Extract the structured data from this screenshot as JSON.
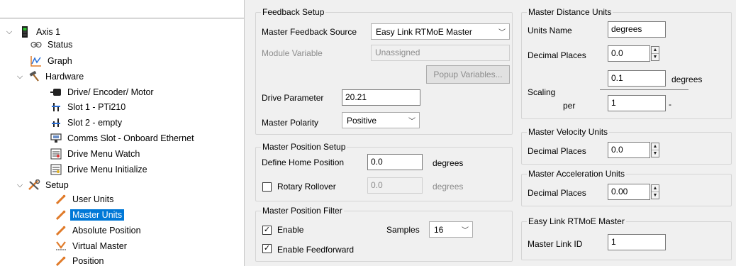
{
  "tree": {
    "axis": "Axis 1",
    "status": "Status",
    "graph": "Graph",
    "hardware": "Hardware",
    "drive_encoder_motor": "Drive/ Encoder/ Motor",
    "slot1": "Slot 1 - PTi210",
    "slot2": "Slot 2 - empty",
    "comms_slot": "Comms Slot - Onboard Ethernet",
    "drive_menu_watch": "Drive Menu Watch",
    "drive_menu_initialize": "Drive Menu Initialize",
    "setup": "Setup",
    "user_units": "User Units",
    "master_units": "Master Units",
    "absolute_position": "Absolute Position",
    "virtual_master": "Virtual Master",
    "position": "Position"
  },
  "feedback_setup": {
    "title": "Feedback Setup",
    "source_label": "Master Feedback Source",
    "source_value": "Easy Link RTMoE Master",
    "module_variable_label": "Module Variable",
    "module_variable_value": "Unassigned",
    "popup_button": "Popup Variables...",
    "drive_parameter_label": "Drive Parameter",
    "drive_parameter_value": "20.21",
    "polarity_label": "Master Polarity",
    "polarity_value": "Positive"
  },
  "position_setup": {
    "title": "Master Position Setup",
    "home_label": "Define Home Position",
    "home_value": "0.0",
    "home_unit": "degrees",
    "rollover_label": "Rotary Rollover",
    "rollover_value": "0.0",
    "rollover_unit": "degrees",
    "rollover_checked": false
  },
  "position_filter": {
    "title": "Master Position Filter",
    "enable_label": "Enable",
    "enable_checked": true,
    "samples_label": "Samples",
    "samples_value": "16",
    "feedforward_label": "Enable Feedforward",
    "feedforward_checked": true
  },
  "distance_units": {
    "title": "Master Distance Units",
    "units_name_label": "Units Name",
    "units_name_value": "degrees",
    "decimal_label": "Decimal Places",
    "decimal_value": "0.0",
    "scaling_label": "Scaling",
    "scaling_top_value": "0.1",
    "scaling_top_unit": "degrees",
    "per_label": "per",
    "scaling_bottom_value": "1",
    "scaling_bottom_unit": "-"
  },
  "velocity_units": {
    "title": "Master Velocity Units",
    "decimal_label": "Decimal Places",
    "decimal_value": "0.0"
  },
  "acceleration_units": {
    "title": "Master Acceleration Units",
    "decimal_label": "Decimal Places",
    "decimal_value": "0.00"
  },
  "easy_link": {
    "title": "Easy Link RTMoE Master",
    "link_id_label": "Master Link ID",
    "link_id_value": "1"
  },
  "colors": {
    "selection": "#0078d7",
    "panel_bg": "#f0f0f0",
    "tool_orange": "#e07b2a"
  }
}
